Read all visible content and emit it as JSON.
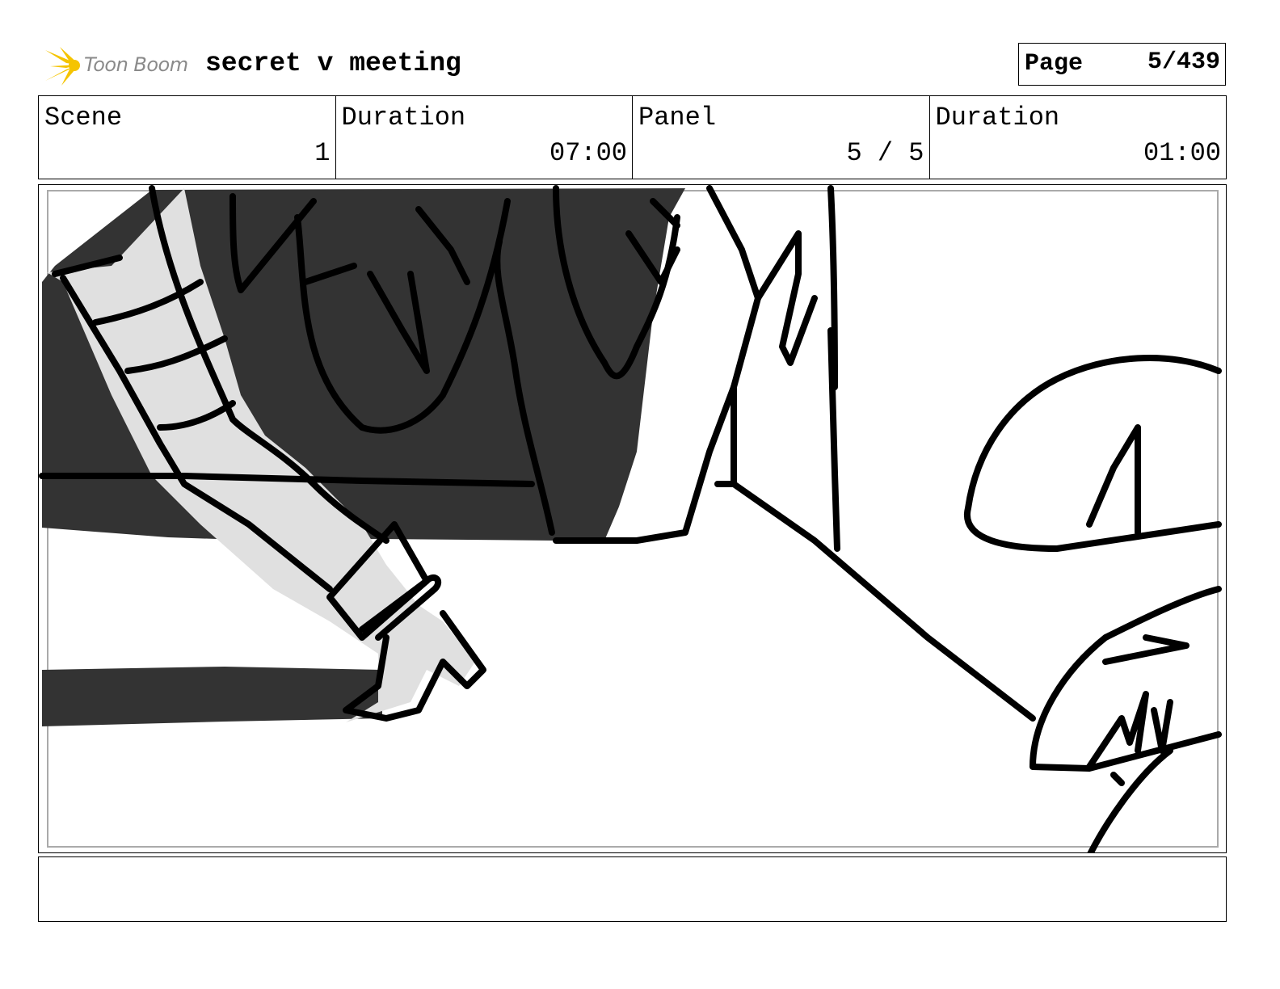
{
  "header": {
    "logo_text": "Toon Boom",
    "project_title": "secret v meeting",
    "page_label": "Page",
    "page_value": "5/439"
  },
  "info": {
    "scene_label": "Scene",
    "scene_value": "1",
    "scene_duration_label": "Duration",
    "scene_duration_value": "07:00",
    "panel_label": "Panel",
    "panel_value": "5 / 5",
    "panel_duration_label": "Duration",
    "panel_duration_value": "01:00"
  },
  "notes": {
    "text": ""
  },
  "colors": {
    "ink": "#000000",
    "dark_fill": "#333333",
    "light_fill": "#e0e0e0",
    "logo_yellow": "#f5c400"
  }
}
